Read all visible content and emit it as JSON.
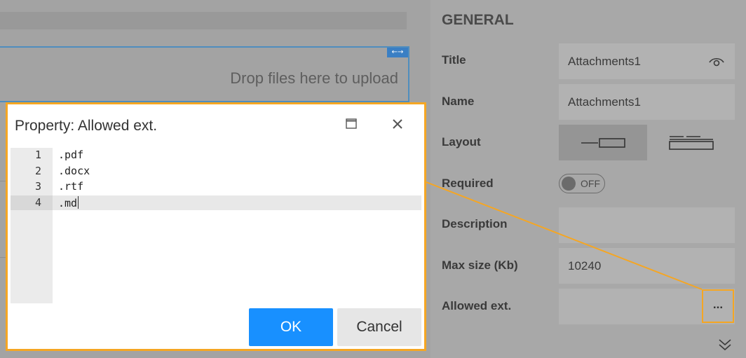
{
  "designer": {
    "drop_placeholder": "Drop files here to upload",
    "resize_glyph": "←→"
  },
  "panel": {
    "heading": "GENERAL",
    "title_label": "Title",
    "title_value": "Attachments1",
    "name_label": "Name",
    "name_value": "Attachments1",
    "layout_label": "Layout",
    "required_label": "Required",
    "required_toggle": "OFF",
    "description_label": "Description",
    "description_value": "",
    "maxsize_label": "Max size (Kb)",
    "maxsize_value": "10240",
    "allowedext_label": "Allowed ext.",
    "allowedext_value": "",
    "dots_label": "..."
  },
  "dialog": {
    "title": "Property: Allowed ext.",
    "lines": [
      {
        "num": "1",
        "text": ".pdf"
      },
      {
        "num": "2",
        "text": ".docx"
      },
      {
        "num": "3",
        "text": ".rtf"
      },
      {
        "num": "4",
        "text": ".md"
      }
    ],
    "ok_label": "OK",
    "cancel_label": "Cancel"
  },
  "colors": {
    "accent_orange": "#f5a623",
    "primary_blue": "#1890ff",
    "selection_blue": "#3a7fc4"
  },
  "icons": {
    "title_visibility": "eye-icon",
    "dialog_maximize": "maximize-icon",
    "dialog_close": "close-icon",
    "panel_collapse": "double-chevron-down-icon"
  }
}
